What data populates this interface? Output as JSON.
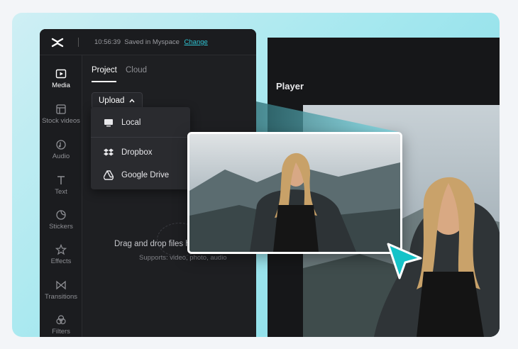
{
  "topbar": {
    "time": "10:56:39",
    "saved_text": "Saved in Myspace",
    "change_link": "Change",
    "logo_icon": "capcut-logo-icon"
  },
  "rail": {
    "items": [
      {
        "label": "Media",
        "icon": "media-icon",
        "active": true
      },
      {
        "label": "Stock videos",
        "icon": "stock-videos-icon"
      },
      {
        "label": "Audio",
        "icon": "audio-icon"
      },
      {
        "label": "Text",
        "icon": "text-icon"
      },
      {
        "label": "Stickers",
        "icon": "stickers-icon"
      },
      {
        "label": "Effects",
        "icon": "effects-icon"
      },
      {
        "label": "Transitions",
        "icon": "transitions-icon"
      },
      {
        "label": "Filters",
        "icon": "filters-icon"
      }
    ]
  },
  "panel": {
    "tabs": [
      {
        "label": "Project",
        "active": true
      },
      {
        "label": "Cloud"
      }
    ],
    "upload_label": "Upload",
    "drop_text": "Drag and drop files h",
    "drop_sub": "Supports: video, photo, audio"
  },
  "upload_menu": {
    "items": [
      {
        "label": "Local",
        "icon": "monitor-icon"
      },
      {
        "label": "Dropbox",
        "icon": "dropbox-icon"
      },
      {
        "label": "Google Drive",
        "icon": "google-drive-icon"
      }
    ]
  },
  "player": {
    "title": "Player"
  },
  "colors": {
    "accent": "#2fc4d4",
    "background_gradient_start": "#cfeff4",
    "background_gradient_end": "#7fd9e6",
    "editor_bg": "#1e1f22"
  }
}
